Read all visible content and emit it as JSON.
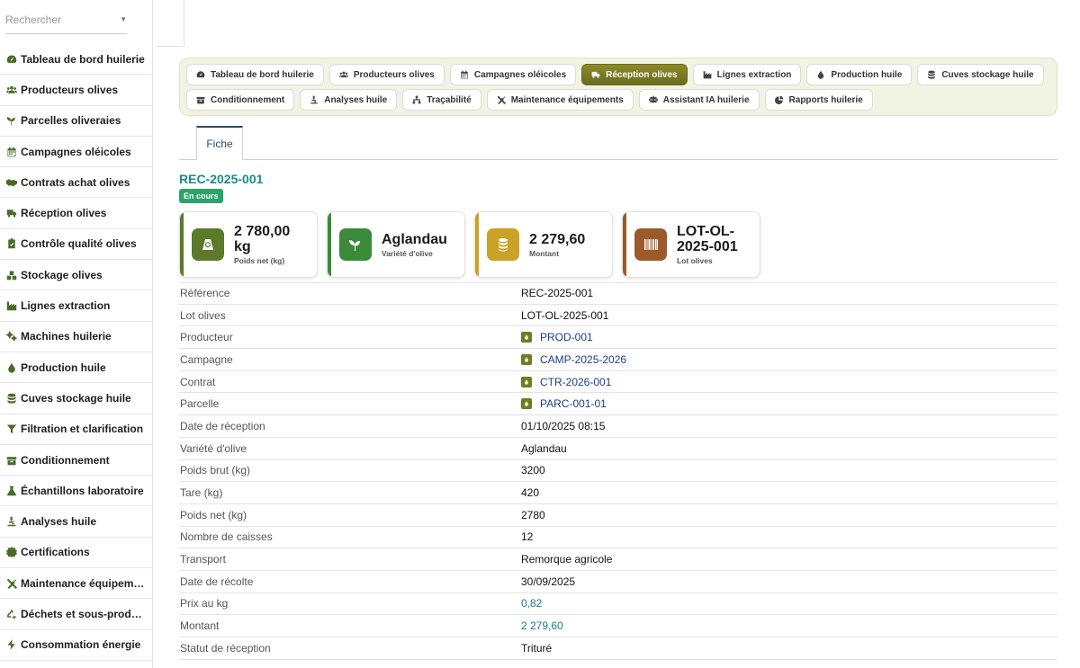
{
  "search": {
    "placeholder": "Rechercher"
  },
  "sidebar": {
    "items": [
      {
        "label": "Tableau de bord huilerie",
        "icon": "gauge-icon"
      },
      {
        "label": "Producteurs olives",
        "icon": "users-icon"
      },
      {
        "label": "Parcelles oliveraies",
        "icon": "seedling-icon"
      },
      {
        "label": "Campagnes oléicoles",
        "icon": "calendar-icon"
      },
      {
        "label": "Contrats achat olives",
        "icon": "handshake-icon"
      },
      {
        "label": "Réception olives",
        "icon": "truck-icon"
      },
      {
        "label": "Contrôle qualité olives",
        "icon": "clipboard-check-icon"
      },
      {
        "label": "Stockage olives",
        "icon": "boxes-icon"
      },
      {
        "label": "Lignes extraction",
        "icon": "industry-icon"
      },
      {
        "label": "Machines huilerie",
        "icon": "cogs-icon"
      },
      {
        "label": "Production huile",
        "icon": "drop-icon"
      },
      {
        "label": "Cuves stockage huile",
        "icon": "database-icon"
      },
      {
        "label": "Filtration et clarification",
        "icon": "filter-icon"
      },
      {
        "label": "Conditionnement",
        "icon": "box-icon"
      },
      {
        "label": "Échantillons laboratoire",
        "icon": "flask-icon"
      },
      {
        "label": "Analyses huile",
        "icon": "microscope-icon"
      },
      {
        "label": "Certifications",
        "icon": "certificate-icon"
      },
      {
        "label": "Maintenance équipements",
        "icon": "tools-icon"
      },
      {
        "label": "Déchets et sous-produits",
        "icon": "recycle-icon"
      },
      {
        "label": "Consommation énergie",
        "icon": "bolt-icon"
      }
    ]
  },
  "nav": {
    "row1": [
      {
        "label": "Tableau de bord huilerie",
        "icon": "gauge-icon"
      },
      {
        "label": "Producteurs olives",
        "icon": "users-icon"
      },
      {
        "label": "Campagnes oléicoles",
        "icon": "calendar-icon"
      },
      {
        "label": "Réception olives",
        "icon": "truck-icon",
        "active": true
      },
      {
        "label": "Lignes extraction",
        "icon": "industry-icon"
      },
      {
        "label": "Production huile",
        "icon": "drop-icon"
      },
      {
        "label": "Cuves stockage huile",
        "icon": "database-icon"
      }
    ],
    "row2": [
      {
        "label": "Conditionnement",
        "icon": "box-icon"
      },
      {
        "label": "Analyses huile",
        "icon": "microscope-icon"
      },
      {
        "label": "Traçabilité",
        "icon": "sitemap-icon"
      },
      {
        "label": "Maintenance équipements",
        "icon": "tools-icon"
      },
      {
        "label": "Assistant IA huilerie",
        "icon": "robot-icon"
      },
      {
        "label": "Rapports huilerie",
        "icon": "pie-chart-icon"
      }
    ]
  },
  "tabs": {
    "fiche": "Fiche"
  },
  "record": {
    "title": "REC-2025-001",
    "status": "En cours"
  },
  "cards": [
    {
      "value": "2 780,00 kg",
      "label": "Poids net (kg)",
      "color": "#5b7a2a",
      "icon": "weight-icon"
    },
    {
      "value": "Aglandau",
      "label": "Variété d'olive",
      "color": "#3a8a3a",
      "icon": "seedling-icon"
    },
    {
      "value": "2 279,60",
      "label": "Montant",
      "color": "#c9a227",
      "icon": "coins-icon"
    },
    {
      "value": "LOT-OL-2025-001",
      "label": "Lot olives",
      "color": "#9a5a2a",
      "icon": "barcode-icon"
    }
  ],
  "details": [
    {
      "key": "Référence",
      "value": "REC-2025-001",
      "kind": "text"
    },
    {
      "key": "Lot olives",
      "value": "LOT-OL-2025-001",
      "kind": "text"
    },
    {
      "key": "Producteur",
      "value": "PROD-001",
      "kind": "link"
    },
    {
      "key": "Campagne",
      "value": "CAMP-2025-2026",
      "kind": "link"
    },
    {
      "key": "Contrat",
      "value": "CTR-2026-001",
      "kind": "link"
    },
    {
      "key": "Parcelle",
      "value": "PARC-001-01",
      "kind": "link"
    },
    {
      "key": "Date de réception",
      "value": "01/10/2025 08:15",
      "kind": "text"
    },
    {
      "key": "Variété d'olive",
      "value": "Aglandau",
      "kind": "text"
    },
    {
      "key": "Poids brut (kg)",
      "value": "3200",
      "kind": "text"
    },
    {
      "key": "Tare (kg)",
      "value": "420",
      "kind": "text"
    },
    {
      "key": "Poids net (kg)",
      "value": "2780",
      "kind": "text"
    },
    {
      "key": "Nombre de caisses",
      "value": "12",
      "kind": "text"
    },
    {
      "key": "Transport",
      "value": "Remorque agricole",
      "kind": "text"
    },
    {
      "key": "Date de récolte",
      "value": "30/09/2025",
      "kind": "text"
    },
    {
      "key": "Prix au kg",
      "value": "0,82",
      "kind": "teal"
    },
    {
      "key": "Montant",
      "value": "2 279,60",
      "kind": "teal"
    },
    {
      "key": "Statut de réception",
      "value": "Trituré",
      "kind": "text"
    }
  ]
}
